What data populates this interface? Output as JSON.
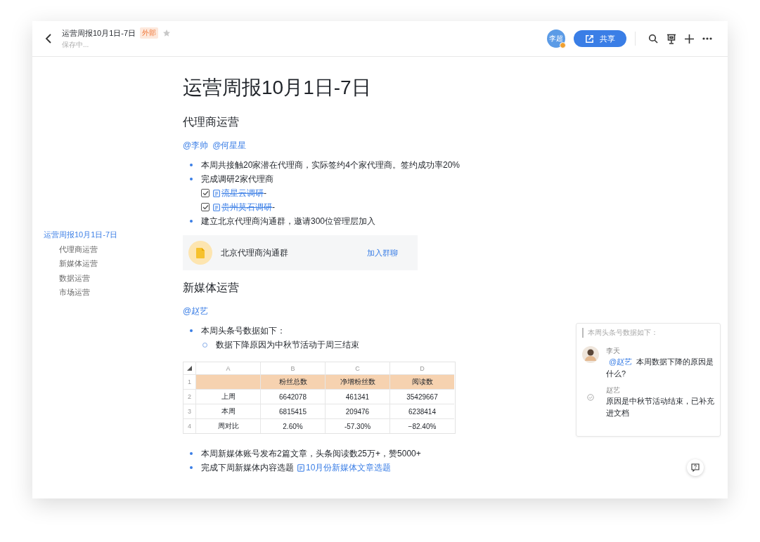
{
  "header": {
    "title": "运营周报10月1日-7日",
    "badge": "外部",
    "starred": false,
    "status": "保存中...",
    "avatar": "李超",
    "share_button": "共享"
  },
  "toc": [
    {
      "label": "运营周报10月1日-7日",
      "selected": true,
      "children": [
        {
          "label": "代理商运营",
          "selected": false
        },
        {
          "label": "新媒体运营",
          "selected": false
        },
        {
          "label": "数据运营",
          "selected": false
        },
        {
          "label": "市场运营",
          "selected": false
        }
      ]
    }
  ],
  "blocks": [
    {
      "kind": "h1",
      "text": "运营周报10月1日-7日"
    },
    {
      "kind": "h2",
      "text": "代理商运营"
    },
    {
      "kind": "mentions",
      "items": [
        "@李帅",
        "@何星星"
      ]
    },
    {
      "kind": "bullet",
      "text": "本周共接触20家潜在代理商，实际签约4个家代理商。签约成功率20%"
    },
    {
      "kind": "bullet",
      "text": "完成调研2家代理商"
    },
    {
      "kind": "todo",
      "checked": true,
      "link": "流星云调研",
      "suffix": "-"
    },
    {
      "kind": "todo",
      "checked": true,
      "link": "贵州莫石调研",
      "suffix": "-"
    },
    {
      "kind": "bullet",
      "text": "建立北京代理商沟通群，邀请300位管理层加入"
    },
    {
      "kind": "group_card",
      "name": "北京代理商沟通群",
      "action": "加入群聊"
    },
    {
      "kind": "h2",
      "text": "新媒体运营"
    },
    {
      "kind": "mentions",
      "items": [
        "@赵艺"
      ]
    },
    {
      "kind": "bullet",
      "text": "本周头条号数据如下："
    },
    {
      "kind": "sub_bullet",
      "text": "数据下降原因为中秋节活动于周三结束"
    },
    {
      "kind": "sheet",
      "columns": [
        "A",
        "B",
        "C",
        "D"
      ],
      "rows": [
        {
          "num": "1",
          "highlight": true,
          "cells": [
            "",
            "粉丝总数",
            "净增粉丝数",
            "阅读数"
          ]
        },
        {
          "num": "2",
          "highlight": false,
          "cells": [
            "上周",
            "6642078",
            "461341",
            "35429667"
          ]
        },
        {
          "num": "3",
          "highlight": false,
          "cells": [
            "本周",
            "6815415",
            "209476",
            "6238414"
          ]
        },
        {
          "num": "4",
          "highlight": false,
          "cells": [
            "周对比",
            "2.60%",
            "-57.30%",
            "−82.40%"
          ]
        }
      ]
    },
    {
      "kind": "bullet",
      "text": "本周新媒体账号发布2篇文章，头条阅读数25万+，赞5000+"
    },
    {
      "kind": "bullet",
      "text": "完成下周新媒体内容选题",
      "link": "10月份新媒体文章选题"
    }
  ],
  "comment": {
    "quote": "本周头条号数据如下：",
    "entries": [
      {
        "author": "李天",
        "avatar": true,
        "mention": "@赵艺",
        "text": "本周数据下降的原因是什么?"
      },
      {
        "author": "赵艺",
        "avatar": false,
        "text": "原因是中秋节活动结束，已补充进文档"
      }
    ]
  }
}
